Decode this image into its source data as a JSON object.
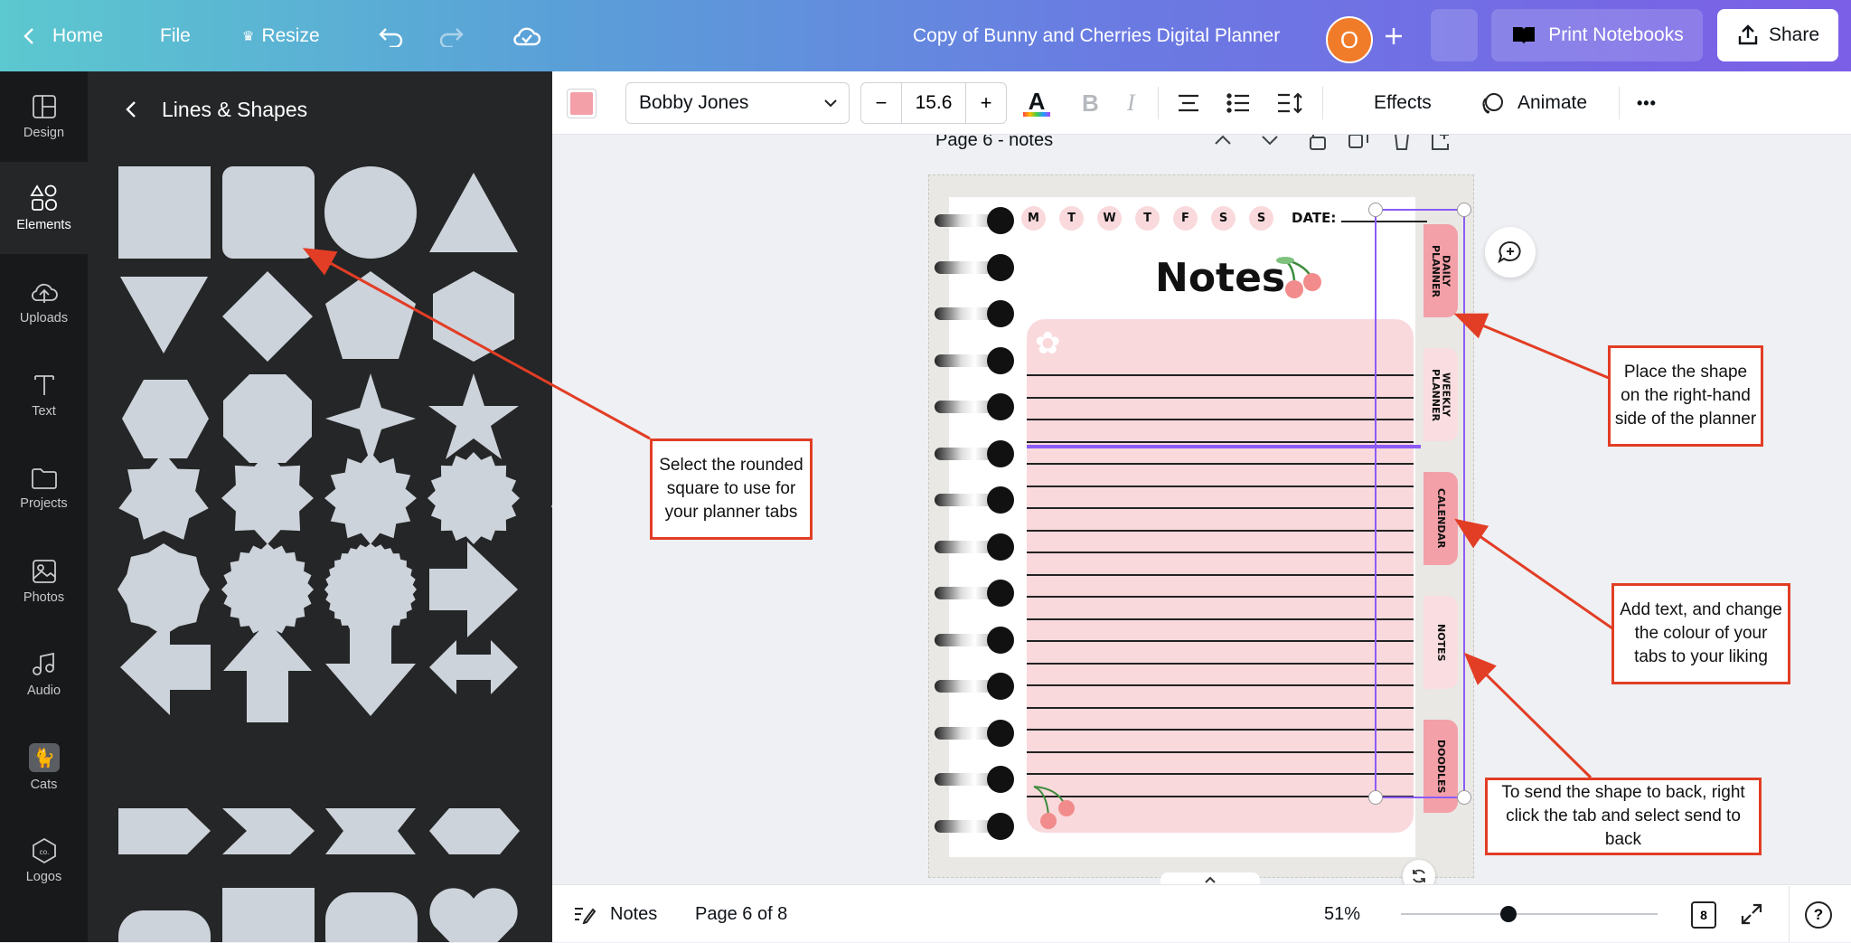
{
  "topbar": {
    "home_label": "Home",
    "file_label": "File",
    "resize_label": "Resize",
    "doc_title": "Copy of Bunny and Cherries Digital Planner",
    "avatar_letter": "O",
    "print_label": "Print Notebooks",
    "share_label": "Share"
  },
  "sidebar": {
    "items": [
      {
        "label": "Design",
        "icon": "design-icon"
      },
      {
        "label": "Elements",
        "icon": "elements-icon"
      },
      {
        "label": "Uploads",
        "icon": "uploads-icon"
      },
      {
        "label": "Text",
        "icon": "text-icon"
      },
      {
        "label": "Projects",
        "icon": "folder-icon"
      },
      {
        "label": "Photos",
        "icon": "photos-icon"
      },
      {
        "label": "Audio",
        "icon": "audio-icon"
      },
      {
        "label": "Cats",
        "icon": "cats-icon"
      },
      {
        "label": "Logos",
        "icon": "logos-icon"
      }
    ],
    "active": "Elements"
  },
  "panel": {
    "title": "Lines & Shapes"
  },
  "toolbar": {
    "font_name": "Bobby Jones",
    "font_size": "15.6",
    "minus": "−",
    "plus": "+",
    "bold": "B",
    "italic": "I",
    "effects_label": "Effects",
    "animate_label": "Animate",
    "more": "•••",
    "swatch_color": "#f3a0a8"
  },
  "page_header": {
    "label": "Page 6 - notes"
  },
  "planner": {
    "days": [
      "M",
      "T",
      "W",
      "T",
      "F",
      "S",
      "S"
    ],
    "date_label": "DATE:",
    "title": "Notes",
    "tabs": [
      {
        "label": "DAILY PLANNER",
        "color": "#f3a0a8"
      },
      {
        "label": "WEEKLY PLANNER",
        "color": "#f9dde0"
      },
      {
        "label": "CALENDAR",
        "color": "#f3a0a8"
      },
      {
        "label": "NOTES",
        "color": "#f9dde0"
      },
      {
        "label": "DOODLES",
        "color": "#f3a0a8"
      }
    ],
    "accent": "#f9d9dc"
  },
  "callouts": {
    "select_shape": "Select the rounded square to use for your planner tabs",
    "place_shape": "Place the shape on the right-hand side of the planner",
    "add_text": "Add text, and change the colour of your tabs to your liking",
    "send_back": "To send the shape to back, right click the tab and select send to back"
  },
  "bottombar": {
    "notes_label": "Notes",
    "page_info": "Page 6 of 8",
    "zoom": "51%",
    "zoom_fraction": 0.42,
    "page_count": "8",
    "help": "?"
  }
}
